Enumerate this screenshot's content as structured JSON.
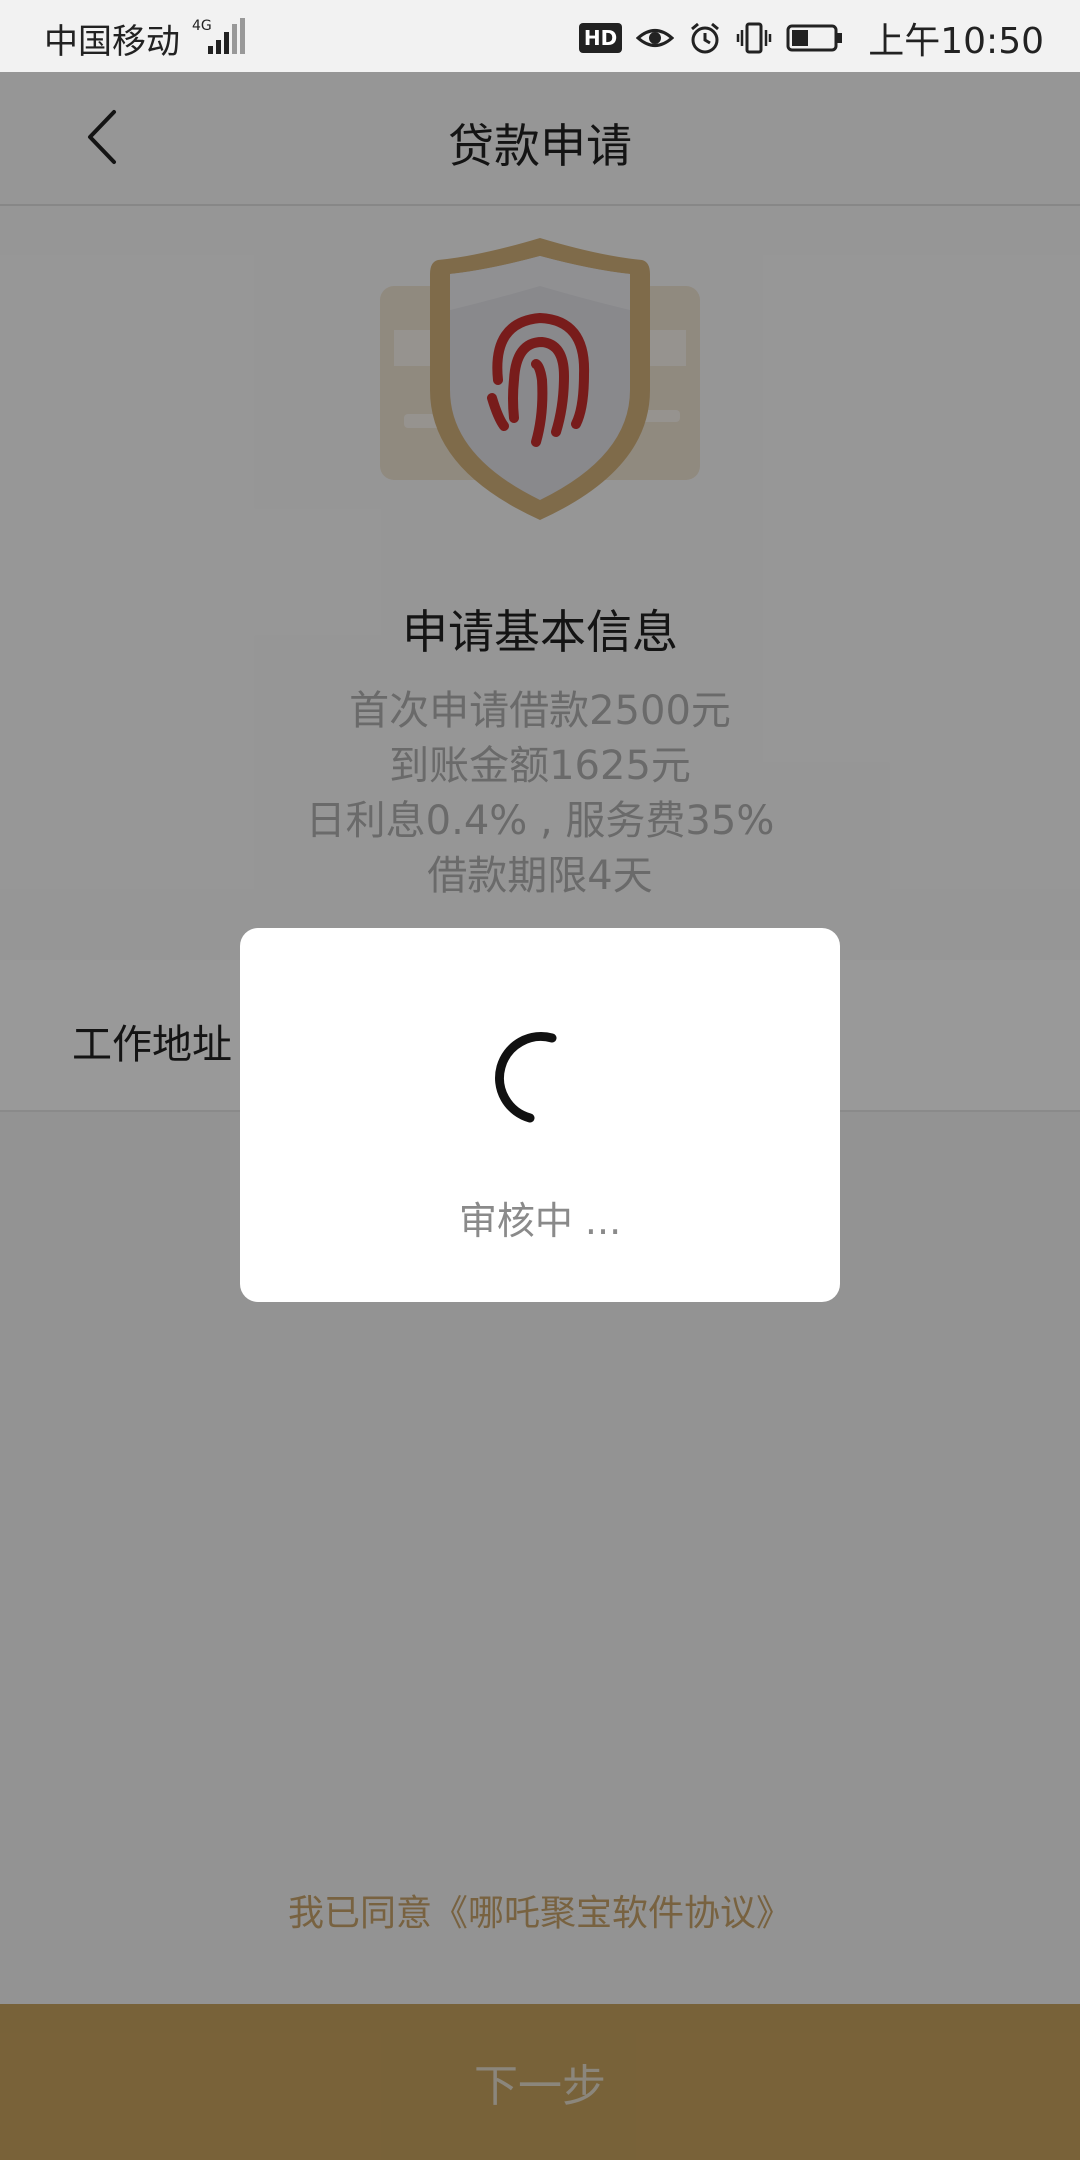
{
  "status_bar": {
    "carrier": "中国移动",
    "network": "4G",
    "hd_badge": "HD",
    "time": "上午10:50"
  },
  "header": {
    "title": "贷款申请"
  },
  "hero": {
    "title": "申请基本信息",
    "lines": [
      "首次申请借款2500元",
      "到账金额1625元",
      "日利息0.4% , 服务费35%",
      "借款期限4天"
    ]
  },
  "form": {
    "work_address_label": "工作地址"
  },
  "agreement": {
    "text": "我已同意《哪吒聚宝软件协议》"
  },
  "next_button": {
    "label": "下一步"
  },
  "dialog": {
    "loading_text": "审核中 ..."
  },
  "colors": {
    "accent_gold": "#c9a45f",
    "agreement_gold": "#c9a46b",
    "fingerprint_red": "#c8302e"
  }
}
